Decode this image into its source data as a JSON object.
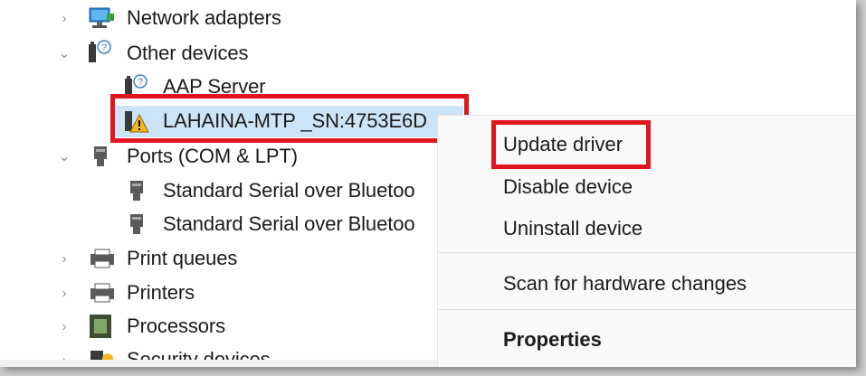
{
  "tree": {
    "network_adapters": "Network adapters",
    "other_devices": "Other devices",
    "aap_server": "AAP Server",
    "lahaina": "LAHAINA-MTP _SN:4753E6D",
    "ports": "Ports (COM & LPT)",
    "serial1": "Standard Serial over Bluetoo",
    "serial2": "Standard Serial over Bluetoo",
    "print_queues": "Print queues",
    "printers": "Printers",
    "processors": "Processors",
    "security_devices": "Security devices"
  },
  "context_menu": {
    "update_driver": "Update driver",
    "disable_device": "Disable device",
    "uninstall_device": "Uninstall device",
    "scan_hardware": "Scan for hardware changes",
    "properties": "Properties"
  },
  "colors": {
    "highlight_box": "#e0161e",
    "selection": "#cce4f7",
    "warning": "#f3b821"
  },
  "icons": {
    "network": "network-adapter-icon",
    "other": "unknown-device-icon",
    "warning": "warning-device-icon",
    "port": "port-icon",
    "printer": "printer-icon",
    "processor": "processor-icon",
    "security": "security-device-icon"
  }
}
